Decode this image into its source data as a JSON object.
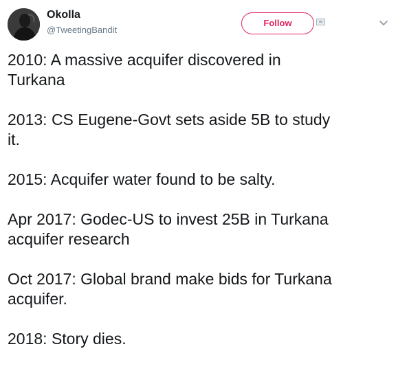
{
  "user": {
    "display_name": "Okolla",
    "screen_name": "@TweetingBandit"
  },
  "header": {
    "follow_label": "Follow",
    "dm_icon": "envelope-icon",
    "menu_icon": "chevron-down-icon"
  },
  "colors": {
    "follow_accent": "#e0245e",
    "secondary_text": "#657786",
    "primary_text": "#14171a"
  },
  "tweet": {
    "lines": [
      "2010: A massive acquifer discovered in",
      "Turkana",
      "2013: CS Eugene-Govt sets aside 5B to study",
      "it.",
      "2015: Acquifer water found to be salty.",
      "Apr 2017: Godec-US to invest 25B in Turkana",
      "acquifer research",
      "Oct 2017: Global brand make bids for Turkana",
      "acquifer.",
      "2018: Story dies."
    ]
  }
}
